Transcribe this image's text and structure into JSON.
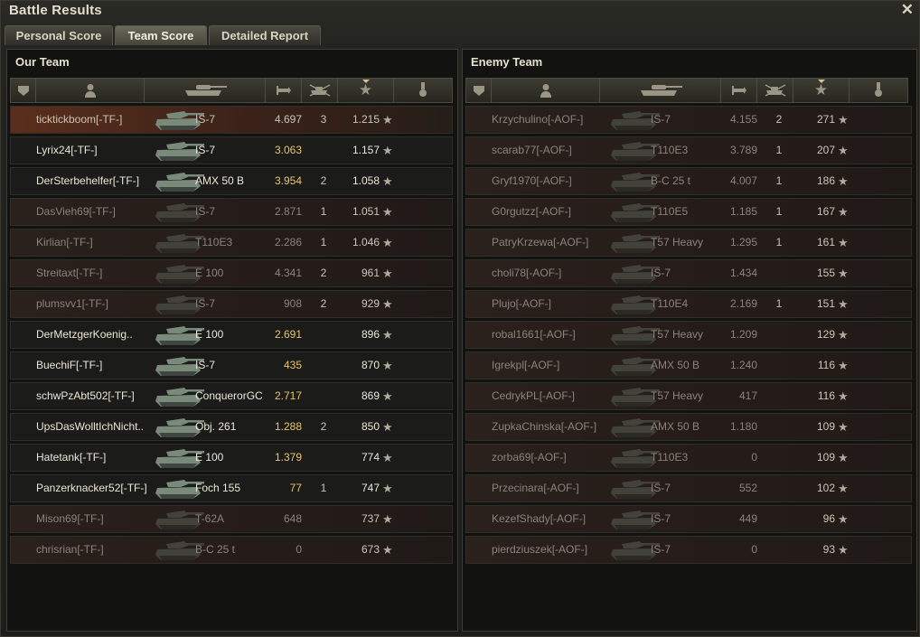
{
  "window": {
    "title": "Battle Results",
    "close_glyph": "✕"
  },
  "tabs": [
    {
      "label": "Personal Score",
      "active": false
    },
    {
      "label": "Team Score",
      "active": true
    },
    {
      "label": "Detailed Report",
      "active": false
    }
  ],
  "columns": [
    "squad-icon",
    "player-icon",
    "tank-icon",
    "damage-icon",
    "kills-icon",
    "xp-star-icon",
    "medal-icon"
  ],
  "star_glyph": "★",
  "our_team": {
    "title": "Our Team",
    "rows": [
      {
        "name": "ticktickboom[-TF-]",
        "tank": "IS-7",
        "damage": "4.697",
        "kills": "3",
        "xp": "1.215",
        "state": "player",
        "dmg_highlight": false
      },
      {
        "name": "Lyrix24[-TF-]",
        "tank": "IS-7",
        "damage": "3.063",
        "kills": "",
        "xp": "1.157",
        "state": "alive",
        "dmg_highlight": true
      },
      {
        "name": "DerSterbehelfer[-TF-]",
        "tank": "AMX 50 B",
        "damage": "3.954",
        "kills": "2",
        "xp": "1.058",
        "state": "alive",
        "dmg_highlight": true
      },
      {
        "name": "DasVieh69[-TF-]",
        "tank": "IS-7",
        "damage": "2.871",
        "kills": "1",
        "xp": "1.051",
        "state": "dead",
        "dmg_highlight": false
      },
      {
        "name": "Kirlian[-TF-]",
        "tank": "T110E3",
        "damage": "2.286",
        "kills": "1",
        "xp": "1.046",
        "state": "dead",
        "dmg_highlight": false
      },
      {
        "name": "Streitaxt[-TF-]",
        "tank": "E 100",
        "damage": "4.341",
        "kills": "2",
        "xp": "961",
        "state": "dead",
        "dmg_highlight": false
      },
      {
        "name": "plumsvv1[-TF-]",
        "tank": "IS-7",
        "damage": "908",
        "kills": "2",
        "xp": "929",
        "state": "dead",
        "dmg_highlight": false
      },
      {
        "name": "DerMetzgerKoenig..",
        "tank": "E 100",
        "damage": "2.691",
        "kills": "",
        "xp": "896",
        "state": "alive",
        "dmg_highlight": true
      },
      {
        "name": "BuechiF[-TF-]",
        "tank": "IS-7",
        "damage": "435",
        "kills": "",
        "xp": "870",
        "state": "alive",
        "dmg_highlight": true
      },
      {
        "name": "schwPzAbt502[-TF-]",
        "tank": "ConquerorGC",
        "damage": "2.717",
        "kills": "",
        "xp": "869",
        "state": "alive",
        "dmg_highlight": true
      },
      {
        "name": "UpsDasWolltIchNicht..",
        "tank": "Obj. 261",
        "damage": "1.288",
        "kills": "2",
        "xp": "850",
        "state": "alive",
        "dmg_highlight": true
      },
      {
        "name": "Hatetank[-TF-]",
        "tank": "E 100",
        "damage": "1.379",
        "kills": "",
        "xp": "774",
        "state": "alive",
        "dmg_highlight": true
      },
      {
        "name": "Panzerknacker52[-TF-]",
        "tank": "Foch 155",
        "damage": "77",
        "kills": "1",
        "xp": "747",
        "state": "alive",
        "dmg_highlight": true
      },
      {
        "name": "Mison69[-TF-]",
        "tank": "T-62A",
        "damage": "648",
        "kills": "",
        "xp": "737",
        "state": "dead",
        "dmg_highlight": false
      },
      {
        "name": "chrisrian[-TF-]",
        "tank": "B-C 25 t",
        "damage": "0",
        "kills": "",
        "xp": "673",
        "state": "dead",
        "dmg_highlight": false
      }
    ]
  },
  "enemy_team": {
    "title": "Enemy Team",
    "rows": [
      {
        "name": "Krzychulino[-AOF-]",
        "tank": "IS-7",
        "damage": "4.155",
        "kills": "2",
        "xp": "271",
        "state": "dead",
        "dmg_highlight": false
      },
      {
        "name": "scarab77[-AOF-]",
        "tank": "T110E3",
        "damage": "3.789",
        "kills": "1",
        "xp": "207",
        "state": "dead",
        "dmg_highlight": false
      },
      {
        "name": "Gryf1970[-AOF-]",
        "tank": "B-C 25 t",
        "damage": "4.007",
        "kills": "1",
        "xp": "186",
        "state": "dead",
        "dmg_highlight": false
      },
      {
        "name": "G0rgutzz[-AOF-]",
        "tank": "T110E5",
        "damage": "1.185",
        "kills": "1",
        "xp": "167",
        "state": "dead",
        "dmg_highlight": false
      },
      {
        "name": "PatryKrzewa[-AOF-]",
        "tank": "T57 Heavy",
        "damage": "1.295",
        "kills": "1",
        "xp": "161",
        "state": "dead",
        "dmg_highlight": false
      },
      {
        "name": "choli78[-AOF-]",
        "tank": "IS-7",
        "damage": "1.434",
        "kills": "",
        "xp": "155",
        "state": "dead",
        "dmg_highlight": false
      },
      {
        "name": "Plujo[-AOF-]",
        "tank": "T110E4",
        "damage": "2.169",
        "kills": "1",
        "xp": "151",
        "state": "dead",
        "dmg_highlight": false
      },
      {
        "name": "robal1661[-AOF-]",
        "tank": "T57 Heavy",
        "damage": "1.209",
        "kills": "",
        "xp": "129",
        "state": "dead",
        "dmg_highlight": false
      },
      {
        "name": "Igrekpl[-AOF-]",
        "tank": "AMX 50 B",
        "damage": "1.240",
        "kills": "",
        "xp": "116",
        "state": "dead",
        "dmg_highlight": false
      },
      {
        "name": "CedrykPL[-AOF-]",
        "tank": "T57 Heavy",
        "damage": "417",
        "kills": "",
        "xp": "116",
        "state": "dead",
        "dmg_highlight": false
      },
      {
        "name": "ZupkaChinska[-AOF-]",
        "tank": "AMX 50 B",
        "damage": "1.180",
        "kills": "",
        "xp": "109",
        "state": "dead",
        "dmg_highlight": false
      },
      {
        "name": "zorba69[-AOF-]",
        "tank": "T110E3",
        "damage": "0",
        "kills": "",
        "xp": "109",
        "state": "dead",
        "dmg_highlight": false
      },
      {
        "name": "Przecinara[-AOF-]",
        "tank": "IS-7",
        "damage": "552",
        "kills": "",
        "xp": "102",
        "state": "dead",
        "dmg_highlight": false
      },
      {
        "name": "KezefShady[-AOF-]",
        "tank": "IS-7",
        "damage": "449",
        "kills": "",
        "xp": "96",
        "state": "dead",
        "dmg_highlight": false
      },
      {
        "name": "pierdziuszek[-AOF-]",
        "tank": "IS-7",
        "damage": "0",
        "kills": "",
        "xp": "93",
        "state": "dead",
        "dmg_highlight": false
      }
    ]
  },
  "colors": {
    "damage_highlight": "#e8c56a",
    "player_row": "#5a2e1c",
    "dead_text": "#8b847a",
    "alive_text": "#ebe7d7"
  }
}
